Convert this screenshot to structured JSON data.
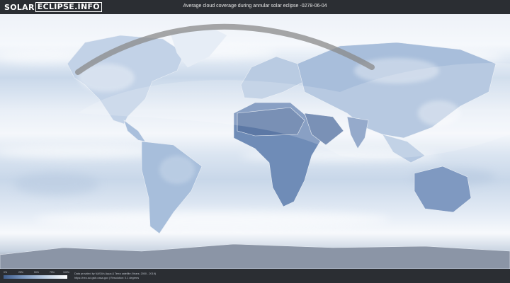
{
  "header": {
    "logo_part1": "SOLAR",
    "logo_part2": "ECLIPSE.INFO",
    "title": "Average cloud coverage during annular solar eclipse -0278-06-04"
  },
  "legend": {
    "ticks": [
      "0%",
      "25%",
      "50%",
      "75%",
      "100%"
    ],
    "colors": [
      "#3f5d8c",
      "#7f9bc2",
      "#c0d0e4",
      "#ffffff"
    ]
  },
  "footer": {
    "credit_line1": "Data provided by NASA's Aqua & Terra satellite (Years: 2000 - 2019)",
    "credit_line2": "https://neo.sci.gsfc.nasa.gov | Resolution: 0.1 degrees"
  },
  "map": {
    "ocean_color": "#d4e0ee",
    "cloud_light": "#eef3f9",
    "clear_sky": "#5a78a6",
    "eclipse_path_color": "#8a8a8a"
  }
}
